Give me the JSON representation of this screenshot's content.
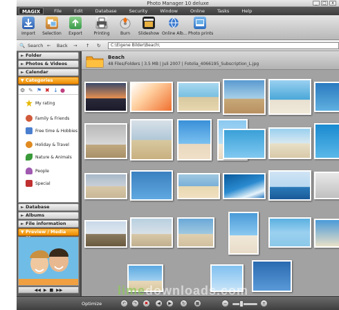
{
  "window": {
    "title": "Photo Manager 10 deluxe",
    "controls": [
      "_",
      "□",
      "x"
    ]
  },
  "menubar": {
    "logo": "MAGIX",
    "items": [
      "File",
      "Edit",
      "Database",
      "Security",
      "Window",
      "Online",
      "Tasks",
      "Help"
    ]
  },
  "toolbar": {
    "buttons": [
      {
        "label": "Import",
        "icon": "import-icon"
      },
      {
        "label": "Selection",
        "icon": "selection-icon"
      },
      {
        "label": "Export",
        "icon": "export-icon"
      },
      {
        "label": "Printing",
        "icon": "printer-icon"
      },
      {
        "label": "Burn",
        "icon": "burn-disc-icon"
      },
      {
        "label": "Slideshow",
        "icon": "slideshow-icon"
      },
      {
        "label": "Online Alb...",
        "icon": "online-album-icon"
      },
      {
        "label": "Photo prints",
        "icon": "photo-prints-icon"
      }
    ]
  },
  "addressbar": {
    "search_label": "Search",
    "back_label": "Back",
    "path": "C:\\Eigene Bilder\\Beach\\"
  },
  "sidebar": {
    "panels": {
      "folder": "Folder",
      "photos_videos": "Photos & Videos",
      "calendar": "Calendar",
      "categories": "Categories",
      "database": "Database",
      "albums": "Albums",
      "file_information": "File information",
      "preview": "Preview / Media Player"
    },
    "categories": [
      {
        "label": "My rating",
        "icon": "star-rating-icon",
        "color": "#e6b800"
      },
      {
        "label": "Family & Friends",
        "icon": "family-icon",
        "color": "#d05a3a"
      },
      {
        "label": "Free time & Hobbies",
        "icon": "hobbies-icon",
        "color": "#4a7fd0"
      },
      {
        "label": "Holiday & Travel",
        "icon": "travel-icon",
        "color": "#e08a20"
      },
      {
        "label": "Nature & Animals",
        "icon": "nature-icon",
        "color": "#3a9a3a"
      },
      {
        "label": "People",
        "icon": "people-icon",
        "color": "#a05ab0"
      },
      {
        "label": "Special",
        "icon": "special-icon",
        "color": "#c03030"
      }
    ]
  },
  "folder": {
    "name": "Beach",
    "info": "48 Files/Folders  |  3.5 MB  |  Juli 2007  |  Fotolia_4066195_Subscription_L.jpg"
  },
  "statusbar": {
    "optimize_label": "Optimize"
  },
  "watermark": {
    "part1": "lime",
    "part2": "downloads.com"
  },
  "colors": {
    "accent": "#f0900a",
    "sidebar_bg": "#5b5b5b",
    "content_bg": "#a2a2a2"
  }
}
